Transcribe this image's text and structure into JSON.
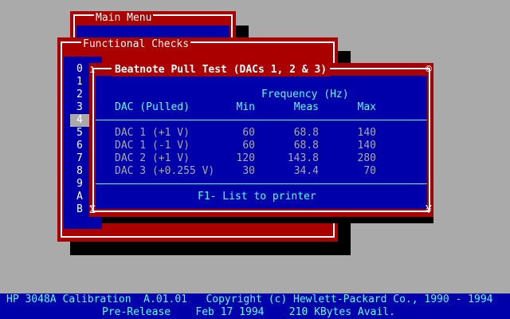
{
  "main_menu": {
    "title": "Main Menu"
  },
  "functional_checks": {
    "title": "Functional Checks",
    "items": [
      "0",
      "1",
      "2",
      "3",
      "4",
      "5",
      "6",
      "7",
      "8",
      "9",
      "A",
      "B"
    ],
    "selected_index": 4
  },
  "dialog": {
    "title": "Beatnote Pull Test (DACs 1, 2 & 3)",
    "corner_tl": "ı",
    "corner_tr": "©",
    "corner_bl": "Σ",
    "corner_br": "¥",
    "group_header": "Frequency (Hz)",
    "columns": {
      "dac": "DAC (Pulled)",
      "min": "Min",
      "meas": "Meas",
      "max": "Max"
    },
    "rows": [
      {
        "dac": "DAC 1 (+1 V)",
        "min": "60",
        "meas": "68.8",
        "max": "140"
      },
      {
        "dac": "DAC 1 (-1 V)",
        "min": "60",
        "meas": "68.8",
        "max": "140"
      },
      {
        "dac": "DAC 2 (+1 V)",
        "min": "120",
        "meas": "143.8",
        "max": "280"
      },
      {
        "dac": "DAC 3 (+0.255 V)",
        "min": "30",
        "meas": "34.4",
        "max": "70"
      }
    ],
    "footer": "F1- List to printer"
  },
  "status": {
    "line1": "HP 3048A Calibration  A.01.01   Copyright (c) Hewlett-Packard Co., 1990 - 1994",
    "line2": "Pre-Release    Feb 17 1994    210 KBytes Avail."
  },
  "colors": {
    "desktop": "#aaaaaa",
    "window_frame": "#aa0000",
    "window_bg": "#0000aa",
    "text": "#55ffff",
    "highlight": "#aaaaaa"
  }
}
